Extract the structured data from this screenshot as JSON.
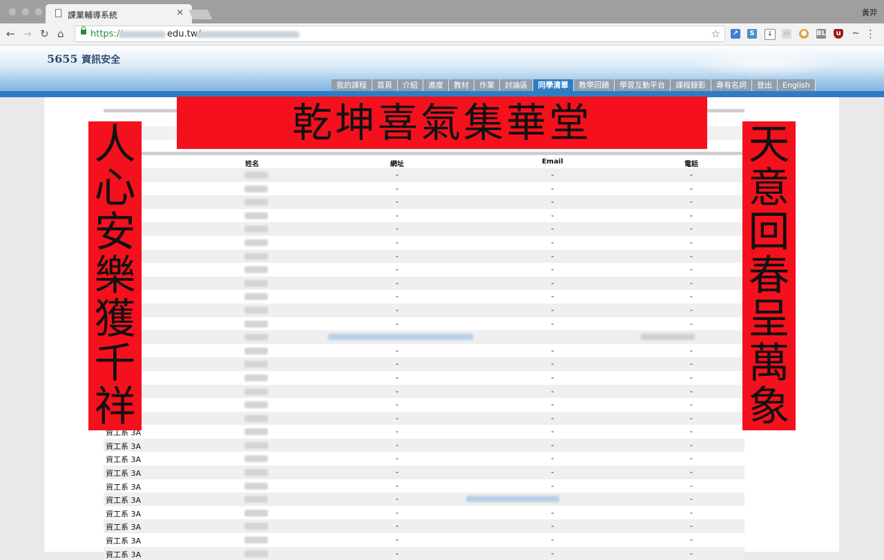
{
  "browser": {
    "tab_title": "課業輔導系統",
    "tab_close": "×",
    "user_name": "黃羿",
    "url_protocol": "https://",
    "url_host_visible": "edu.tw/"
  },
  "site": {
    "title_number": "5655",
    "title_text": "資訊安全",
    "nav": [
      {
        "label": "我的課程"
      },
      {
        "label": "首頁"
      },
      {
        "label": "介紹"
      },
      {
        "label": "進度"
      },
      {
        "label": "教材"
      },
      {
        "label": "作業"
      },
      {
        "label": "討論區"
      },
      {
        "label": "同學清單",
        "active": true
      },
      {
        "label": "教學回饋"
      },
      {
        "label": "學習互動平台"
      },
      {
        "label": "課程錄影"
      },
      {
        "label": "專有名詞"
      },
      {
        "label": "登出"
      },
      {
        "label": "English"
      }
    ]
  },
  "table": {
    "headers": {
      "name": "姓名",
      "website": "網址",
      "email": "Email",
      "phone": "電話"
    },
    "dash": "-",
    "visible_dept": "資工系 3A"
  },
  "couplets": {
    "top": "乾坤喜氣集華堂",
    "left": [
      "人",
      "心",
      "安",
      "樂",
      "獲",
      "千",
      "祥"
    ],
    "right": [
      "天",
      "意",
      "回",
      "春",
      "呈",
      "萬",
      "象"
    ]
  },
  "colors": {
    "nav_bg": "#8f9fad",
    "nav_active": "#2f7cc4",
    "banner_red": "#f5101d"
  }
}
